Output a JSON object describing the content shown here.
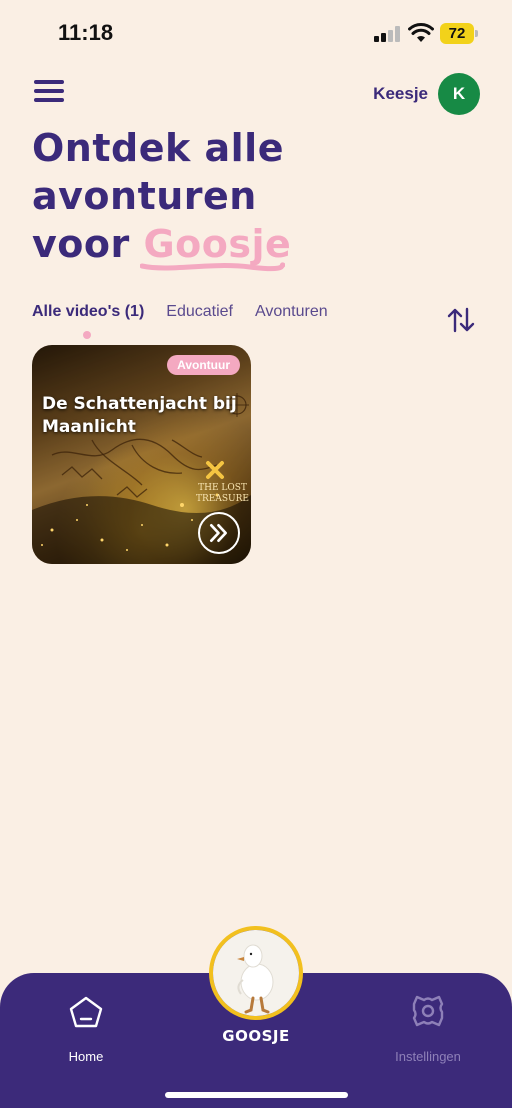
{
  "status_bar": {
    "time": "11:18",
    "battery": "72",
    "signal_icon": "cellular-signal-icon",
    "wifi_icon": "wifi-icon"
  },
  "header": {
    "menu_icon": "hamburger-menu-icon",
    "user_name": "Keesje",
    "avatar_initial": "K",
    "avatar_color": "#178A45"
  },
  "heading": {
    "line1": "Ontdek alle",
    "line2": "avonturen",
    "line3_prefix": "voor ",
    "child_name": "Goosje"
  },
  "tabs": [
    {
      "label": "Alle video's (1)",
      "active": true
    },
    {
      "label": "Educatief",
      "active": false
    },
    {
      "label": "Avonturen",
      "active": false
    }
  ],
  "sort_icon": "sort-arrows-icon",
  "videos": [
    {
      "badge": "Avontuur",
      "title": "De Schattenjacht bij Maanlicht",
      "map_label": "THE LOST TREASURE",
      "play_icon": "double-chevron-right-icon"
    }
  ],
  "bottom_nav": {
    "home_label": "Home",
    "center_label": "GOOSJE",
    "settings_label": "Instellingen",
    "home_icon": "home-icon",
    "settings_icon": "settings-gear-icon"
  },
  "colors": {
    "background": "#FAEFE4",
    "primary": "#3B2A7A",
    "accent_pink": "#F4A9C1",
    "nav_background": "#3C2A7A",
    "center_ring": "#F2C01E"
  }
}
